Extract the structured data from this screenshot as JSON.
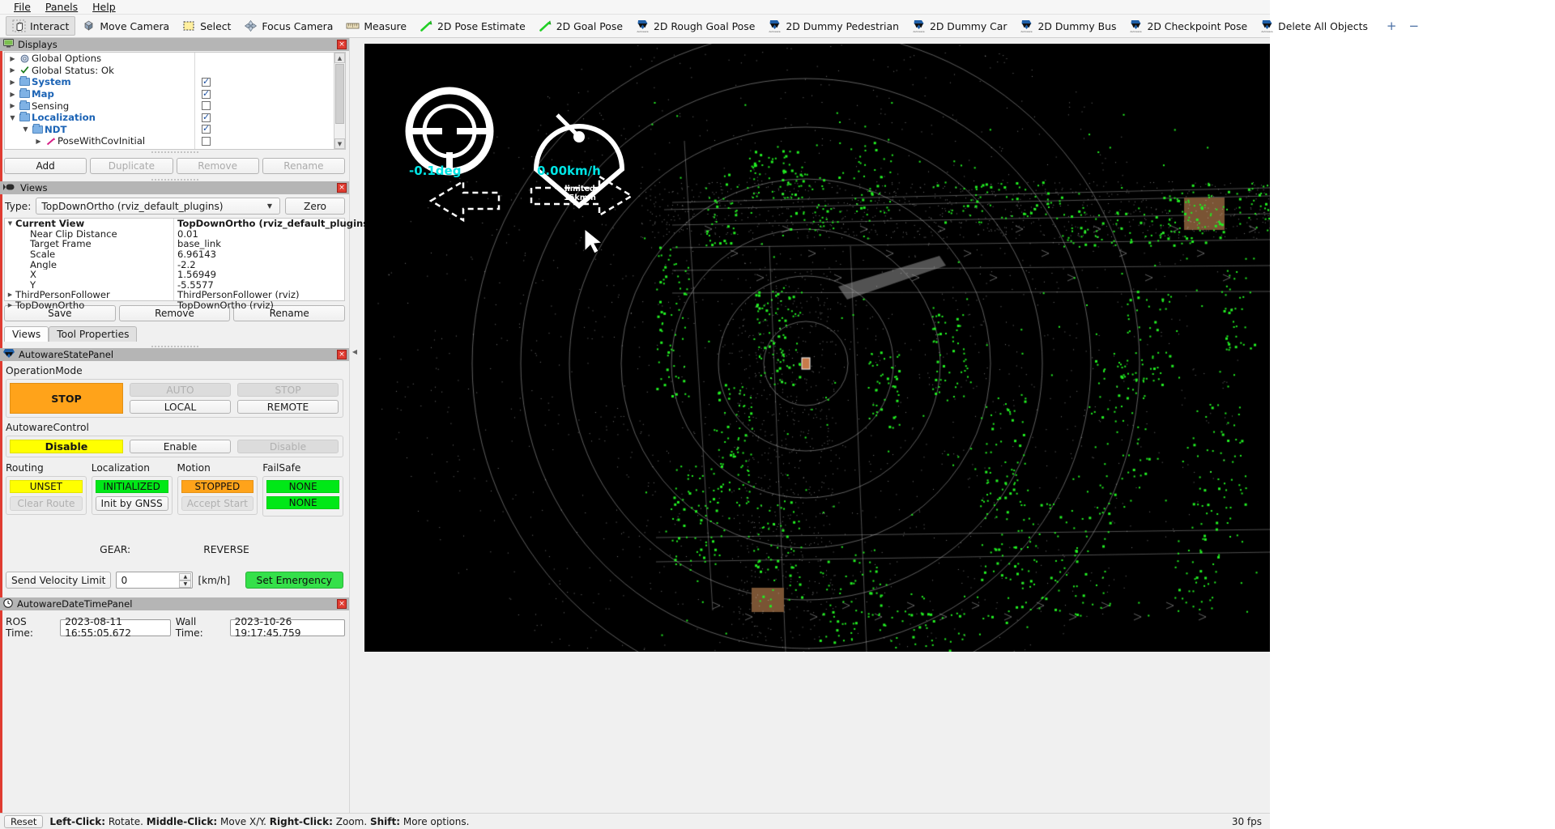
{
  "menu": {
    "items": [
      "File",
      "Panels",
      "Help"
    ]
  },
  "toolbar": {
    "items": [
      {
        "label": "Interact",
        "icon": "hand-icon",
        "active": true
      },
      {
        "label": "Move Camera",
        "icon": "move-camera-icon",
        "active": false
      },
      {
        "label": "Select",
        "icon": "select-icon",
        "active": false
      },
      {
        "label": "Focus Camera",
        "icon": "focus-camera-icon",
        "active": false
      },
      {
        "label": "Measure",
        "icon": "ruler-icon",
        "active": false
      },
      {
        "label": "2D Pose Estimate",
        "icon": "green-arrow-icon",
        "active": false
      },
      {
        "label": "2D Goal Pose",
        "icon": "green-arrow-icon",
        "active": false
      },
      {
        "label": "2D Rough Goal Pose",
        "icon": "autoware-logo-icon",
        "active": false
      },
      {
        "label": "2D Dummy Pedestrian",
        "icon": "autoware-logo-icon",
        "active": false
      },
      {
        "label": "2D Dummy Car",
        "icon": "autoware-logo-icon",
        "active": false
      },
      {
        "label": "2D Dummy Bus",
        "icon": "autoware-logo-icon",
        "active": false
      },
      {
        "label": "2D Checkpoint Pose",
        "icon": "autoware-logo-icon",
        "active": false
      },
      {
        "label": "Delete All Objects",
        "icon": "autoware-logo-icon",
        "active": false
      }
    ],
    "add_label": "+",
    "remove_label": "−"
  },
  "displays": {
    "title": "Displays",
    "close_label": "×",
    "tree": [
      {
        "label": "Global Options",
        "icon": "gear-icon",
        "expander": "closed",
        "bold": false,
        "checkbox": null,
        "indent": 0
      },
      {
        "label": "Global Status: Ok",
        "icon": "check-icon",
        "expander": "closed",
        "bold": false,
        "checkbox": null,
        "indent": 0
      },
      {
        "label": "System",
        "icon": "folder-icon",
        "expander": "closed",
        "bold": true,
        "checkbox": true,
        "indent": 0
      },
      {
        "label": "Map",
        "icon": "folder-icon",
        "expander": "closed",
        "bold": true,
        "checkbox": true,
        "indent": 0
      },
      {
        "label": "Sensing",
        "icon": "folder-icon",
        "expander": "closed",
        "bold": false,
        "checkbox": false,
        "indent": 0
      },
      {
        "label": "Localization",
        "icon": "folder-icon",
        "expander": "open",
        "bold": true,
        "checkbox": true,
        "indent": 0
      },
      {
        "label": "NDT",
        "icon": "folder-icon",
        "expander": "open",
        "bold": true,
        "checkbox": true,
        "indent": 1
      },
      {
        "label": "PoseWithCovInitial",
        "icon": "pose-arrow-icon",
        "expander": "closed",
        "bold": false,
        "checkbox": false,
        "indent": 2
      }
    ],
    "buttons": [
      {
        "label": "Add",
        "disabled": false
      },
      {
        "label": "Duplicate",
        "disabled": true
      },
      {
        "label": "Remove",
        "disabled": true
      },
      {
        "label": "Rename",
        "disabled": true
      }
    ]
  },
  "views": {
    "title": "Views",
    "close_label": "×",
    "type_label": "Type:",
    "type_value": "TopDownOrtho (rviz_default_plugins)",
    "zero_label": "Zero",
    "rows": [
      {
        "name": "Current View",
        "value": "TopDownOrtho (rviz_default_plugins",
        "expander": "open",
        "bold": true,
        "indent": 0
      },
      {
        "name": "Near Clip Distance",
        "value": "0.01",
        "expander": "none",
        "bold": false,
        "indent": 1
      },
      {
        "name": "Target Frame",
        "value": "base_link",
        "expander": "none",
        "bold": false,
        "indent": 1
      },
      {
        "name": "Scale",
        "value": "6.96143",
        "expander": "none",
        "bold": false,
        "indent": 1
      },
      {
        "name": "Angle",
        "value": "-2.2",
        "expander": "none",
        "bold": false,
        "indent": 1
      },
      {
        "name": "X",
        "value": "1.56949",
        "expander": "none",
        "bold": false,
        "indent": 1
      },
      {
        "name": "Y",
        "value": "-5.5577",
        "expander": "none",
        "bold": false,
        "indent": 1
      },
      {
        "name": "ThirdPersonFollower",
        "value": "ThirdPersonFollower (rviz)",
        "expander": "closed",
        "bold": false,
        "indent": 0
      },
      {
        "name": "TopDownOrtho",
        "value": "TopDownOrtho (rviz)",
        "expander": "closed",
        "bold": false,
        "indent": 0
      }
    ],
    "buttons": [
      {
        "label": "Save",
        "disabled": false
      },
      {
        "label": "Remove",
        "disabled": false
      },
      {
        "label": "Rename",
        "disabled": false
      }
    ],
    "tabs": [
      {
        "label": "Views",
        "selected": true
      },
      {
        "label": "Tool Properties",
        "selected": false
      }
    ]
  },
  "state_panel": {
    "title": "AutowareStatePanel",
    "close_label": "×",
    "operation_mode": {
      "label": "OperationMode",
      "current": {
        "label": "STOP",
        "color": "#FFA31A"
      },
      "buttons": [
        {
          "label": "AUTO",
          "disabled": true
        },
        {
          "label": "LOCAL",
          "disabled": false
        },
        {
          "label": "STOP",
          "disabled": true
        },
        {
          "label": "REMOTE",
          "disabled": false
        }
      ]
    },
    "autoware_control": {
      "label": "AutowareControl",
      "current": {
        "label": "Disable",
        "color": "#FFFF00"
      },
      "buttons": [
        {
          "label": "Enable",
          "disabled": false
        },
        {
          "label": "Disable",
          "disabled": true
        }
      ]
    },
    "status_columns": [
      {
        "header": "Routing",
        "badges": [
          {
            "label": "UNSET",
            "color": "#FFFF00"
          }
        ],
        "button": {
          "label": "Clear Route",
          "disabled": true
        }
      },
      {
        "header": "Localization",
        "badges": [
          {
            "label": "INITIALIZED",
            "color": "#00E817"
          }
        ],
        "button": {
          "label": "Init by GNSS",
          "disabled": false
        }
      },
      {
        "header": "Motion",
        "badges": [
          {
            "label": "STOPPED",
            "color": "#FFA31A"
          }
        ],
        "button": {
          "label": "Accept Start",
          "disabled": true
        }
      },
      {
        "header": "FailSafe",
        "badges": [
          {
            "label": "NONE",
            "color": "#00E817"
          },
          {
            "label": "NONE",
            "color": "#00E817"
          }
        ],
        "button": null
      }
    ],
    "gear": {
      "label": "GEAR:",
      "value": "REVERSE"
    },
    "velocity": {
      "send_label": "Send Velocity Limit",
      "value": "0",
      "unit": "[km/h]",
      "emergency_label": "Set Emergency",
      "emergency_color": "#35E04A"
    }
  },
  "datetime_panel": {
    "title": "AutowareDateTimePanel",
    "close_label": "×",
    "ros_time_label": "ROS Time:",
    "ros_time_value": "2023-08-11 16:55:05.672",
    "wall_time_label": "Wall Time:",
    "wall_time_value": "2023-10-26 19:17:45.759"
  },
  "statusbar": {
    "reset_label": "Reset",
    "hints": [
      {
        "bold": "Left-Click:",
        "text": " Rotate."
      },
      {
        "bold": "Middle-Click:",
        "text": " Move X/Y."
      },
      {
        "bold": "Right-Click:",
        "text": " Zoom."
      },
      {
        "bold": "Shift:",
        "text": " More options."
      }
    ],
    "fps": "30 fps"
  },
  "viewport": {
    "steering_value": "-0.1deg",
    "speed_value": "0.00km/h",
    "speed_limit_line1": "limited",
    "speed_limit_line2": "15km/h",
    "hud_color": "#00E5E5"
  }
}
